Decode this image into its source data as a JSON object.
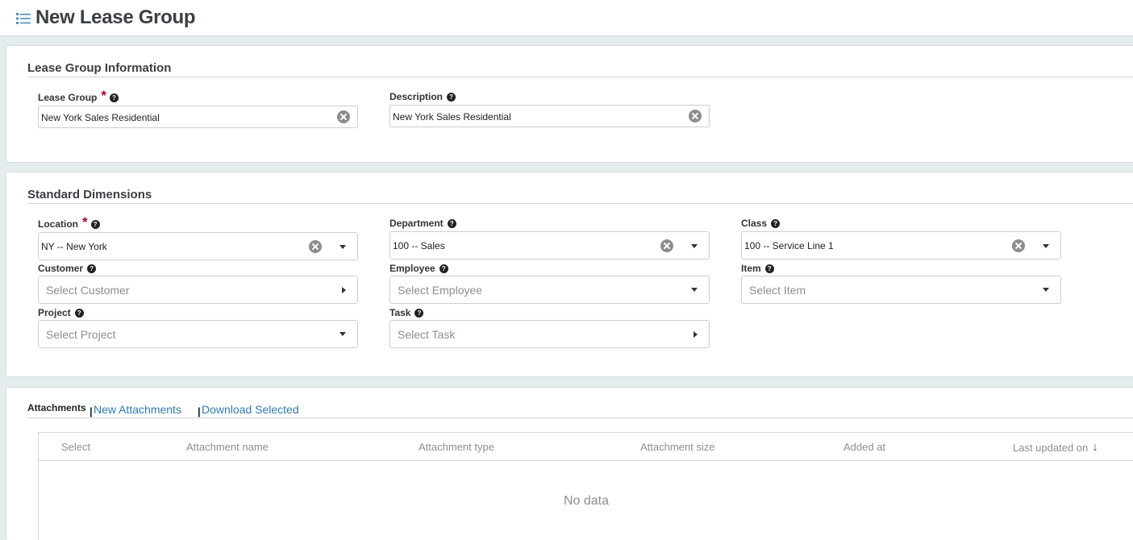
{
  "header": {
    "title": "New Lease Group",
    "icon": "list-icon"
  },
  "lease_group_info": {
    "section_title": "Lease Group Information",
    "lease_group": {
      "label": "Lease Group",
      "required": true,
      "value": "New York Sales Residential"
    },
    "description": {
      "label": "Description",
      "value": "New York Sales Residential"
    }
  },
  "standard_dimensions": {
    "section_title": "Standard Dimensions",
    "location": {
      "label": "Location",
      "required": true,
      "value": "NY -- New York"
    },
    "department": {
      "label": "Department",
      "value": "100 -- Sales"
    },
    "class": {
      "label": "Class",
      "value": "100 -- Service Line 1"
    },
    "customer": {
      "label": "Customer",
      "placeholder": "Select Customer"
    },
    "employee": {
      "label": "Employee",
      "placeholder": "Select Employee"
    },
    "item": {
      "label": "Item",
      "placeholder": "Select Item"
    },
    "project": {
      "label": "Project",
      "placeholder": "Select Project"
    },
    "task": {
      "label": "Task",
      "placeholder": "Select Task"
    }
  },
  "attachments": {
    "tab_active": "Attachments",
    "separator": "|",
    "new_attachments": "New Attachments",
    "download_selected": "Download Selected",
    "columns": [
      "Select",
      "Attachment name",
      "Attachment type",
      "Attachment size",
      "Added at",
      "Last updated on"
    ],
    "sort_indicator": "↓",
    "empty_text": "No data"
  },
  "colors": {
    "link": "#2e7bb8",
    "required": "#b00020",
    "page_bg": "#e4ecee"
  }
}
